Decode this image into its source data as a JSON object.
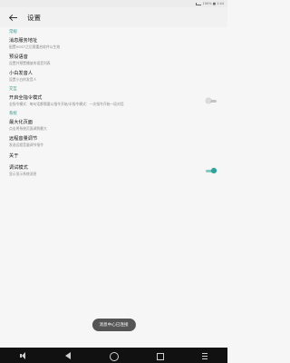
{
  "status_bar": {
    "battery_text": "100% ■ 1:44"
  },
  "app_bar": {
    "title": "设置"
  },
  "sections": [
    {
      "header": "常规",
      "items": [
        {
          "title": "消息服务地址",
          "subtitle": "配置HOST之后需重启软件以生效"
        },
        {
          "title": "预设语音",
          "subtitle": "设置并预置播放的语音列表"
        },
        {
          "title": "小白发音人",
          "subtitle": "设置小白的发音人"
        }
      ]
    },
    {
      "header": "交互",
      "items": [
        {
          "title": "开启全指令模式",
          "subtitle": "全指令模式：每句话都需要以指令开始/半指令模式：一次指令开始一段对话",
          "toggle": "off"
        }
      ]
    },
    {
      "header": "系统",
      "items": [
        {
          "title": "最大化页面",
          "subtitle": "点击将系统页面调到最大"
        },
        {
          "title": "远程音量调节",
          "subtitle": "发送远程音量调节指令"
        },
        {
          "title": "关于"
        },
        {
          "title": "调试模式",
          "subtitle": "显示显示系统消息",
          "toggle": "on"
        }
      ]
    }
  ],
  "toast": {
    "text": "消息中心已连接"
  },
  "colors": {
    "accent": "#26a69a",
    "section_header": "#2a9d8f",
    "background": "#f6f6f6"
  },
  "nav_icons": [
    "volume-icon",
    "back-icon",
    "home-icon",
    "recent-apps-icon",
    "menu-icon"
  ]
}
